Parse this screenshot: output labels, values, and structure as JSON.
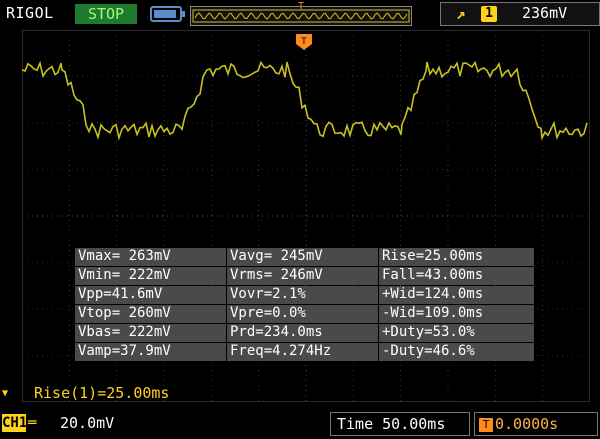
{
  "header": {
    "brand": "RIGOL",
    "run_state": "STOP",
    "trigger_level": "236mV",
    "trigger_channel": "1",
    "trigger_edge_icon": "rising-edge-icon",
    "trigger_marker": "T"
  },
  "measurements": {
    "rows": [
      [
        "Vmax= 263mV",
        "Vavg= 245mV",
        "Rise=25.00ms"
      ],
      [
        "Vmin= 222mV",
        "Vrms= 246mV",
        "Fall=43.00ms"
      ],
      [
        "Vpp=41.6mV",
        "Vovr=2.1%",
        "+Wid=124.0ms"
      ],
      [
        "Vtop= 260mV",
        "Vpre=0.0%",
        "-Wid=109.0ms"
      ],
      [
        "Vbas= 222mV",
        "Prd=234.0ms",
        "+Duty=53.0%"
      ],
      [
        "Vamp=37.9mV",
        "Freq=4.274Hz",
        "-Duty=46.6%"
      ]
    ]
  },
  "cursor_readout": "Rise(1)=25.00ms",
  "footer": {
    "channel": "CH1",
    "channel_scale": "20.0mV",
    "timebase": "Time 50.00ms",
    "trigger_offset": "0.0000s",
    "trigger_offset_icon": "T"
  },
  "colors": {
    "trace": "#c8c21e",
    "accent_yellow": "#ffd21a",
    "trigger_orange": "#ff8a1a",
    "stop_green": "#1e7a2e",
    "grid": "#555555"
  },
  "waveform": {
    "high_level": "Vtop= 260mV",
    "low_level": "Vbas= 222mV",
    "period": "Prd=234.0ms"
  }
}
